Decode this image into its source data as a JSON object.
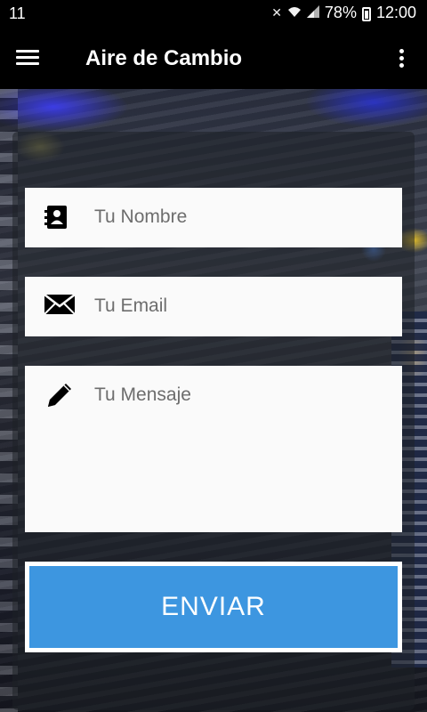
{
  "status_bar": {
    "left_text": "11",
    "battery": "78%",
    "time": "12:00"
  },
  "app_bar": {
    "title": "Aire de Cambio",
    "menu_icon": "hamburger-menu-icon",
    "overflow_icon": "more-vert-icon"
  },
  "form": {
    "name_placeholder": "Tu Nombre",
    "email_placeholder": "Tu Email",
    "message_placeholder": "Tu Mensaje",
    "submit_label": "ENVIAR",
    "icons": [
      "contact-card-icon",
      "envelope-icon",
      "pencil-icon"
    ]
  },
  "colors": {
    "app_bar": "#000000",
    "button": "#3d96e0",
    "field_bg": "#fafafa",
    "placeholder": "#6d6d6d"
  }
}
